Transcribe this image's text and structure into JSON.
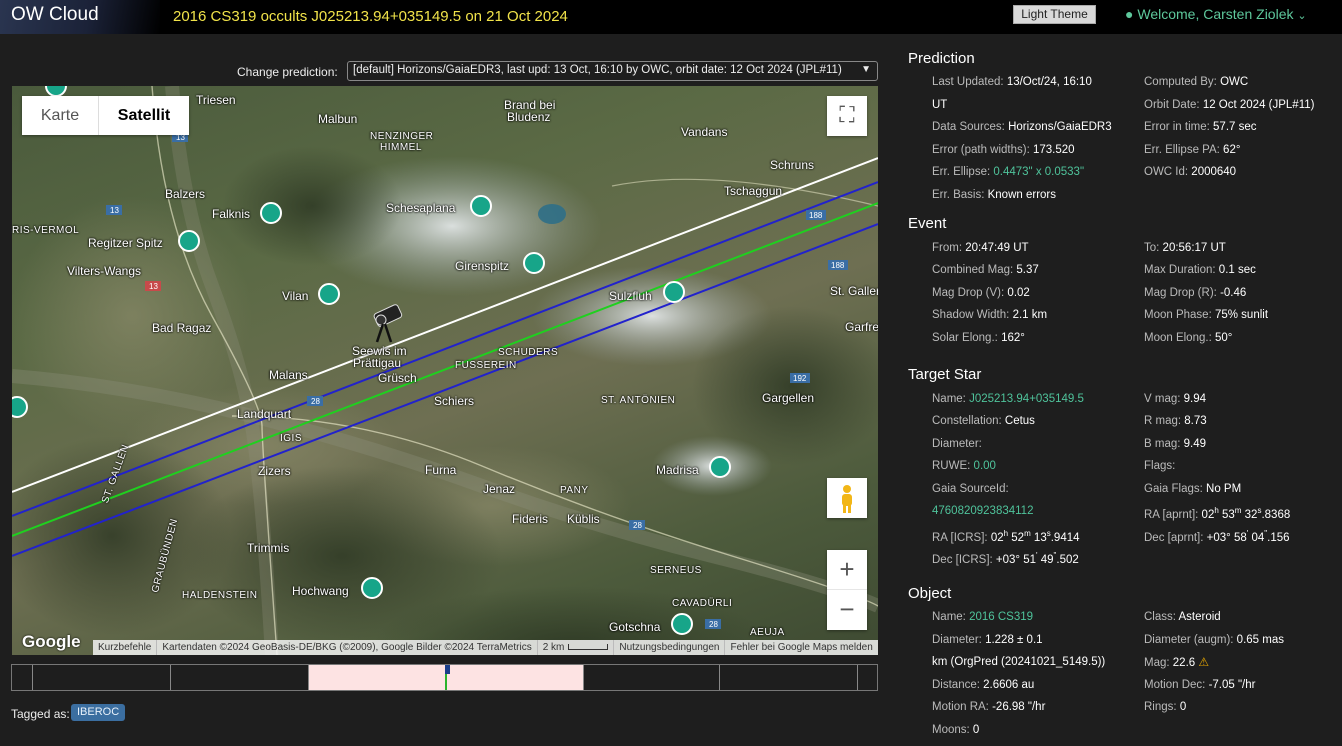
{
  "header": {
    "logo": "OW Cloud",
    "event_title": "2016 CS319 occults J025213.94+035149.5 on 21 Oct 2024",
    "theme_button": "Light Theme",
    "welcome": "Welcome, Carsten Ziolek",
    "colors": {
      "title": "#f1e34a",
      "welcome": "#5ec89c"
    }
  },
  "prediction_selector": {
    "label": "Change prediction:",
    "selected": "[default] Horizons/GaiaEDR3, last upd: 13 Oct, 16:10 by OWC, orbit date: 12 Oct 2024 (JPL#11)"
  },
  "map": {
    "type_buttons": {
      "map": "Karte",
      "satellite": "Satellit"
    },
    "google": "Google",
    "attribution": {
      "shortcuts": "Kurzbefehle",
      "data": "Kartendaten ©2024 GeoBasis-DE/BKG (©2009), Google Bilder ©2024 TerraMetrics",
      "scale": "2 km",
      "terms": "Nutzungsbedingungen",
      "report": "Fehler bei Google Maps melden"
    },
    "places": {
      "triesen": "Triesen",
      "malbun": "Malbun",
      "brand": "Brand bei",
      "bludenz": "Bludenz",
      "nenzinger": "NENZINGER",
      "himmel": "HIMMEL",
      "vandans": "Vandans",
      "schruns": "Schruns",
      "balzers": "Balzers",
      "falknis": "Falknis",
      "schesaplana": "Schesaplana",
      "tschaggun": "Tschaggun",
      "regitzen": "Regitzer Spitz",
      "vilters": "Vilters-Wangs",
      "girenspitz": "Girenspitz",
      "sulzfluh": "Sulzfluh",
      "stgallen": "St. Galler",
      "vilan": "Vilan",
      "badragaz": "Bad Ragaz",
      "garfre": "Garfre",
      "seewis": "Seewis im",
      "prattigau": "Prättigau",
      "schuders": "SCHUDERS",
      "fusserein": "FUSSEREIN",
      "malans": "Malans",
      "grusch": "Grüsch",
      "landquart": "Landquart",
      "schiers": "Schiers",
      "stantonien": "ST. ANTÖNIEN",
      "gargellen": "Gargellen",
      "igis": "IGIS",
      "zizers": "Zizers",
      "furna": "Furna",
      "madrisa": "Madrisa",
      "jenaz": "Jenaz",
      "pany": "PANY",
      "fideris": "Fideris",
      "kublis": "Küblis",
      "trimmis": "Trimmis",
      "serneus": "SERNEUS",
      "hochwang": "Hochwang",
      "haldenstein": "HALDENSTEIN",
      "cavadurli": "CAVADÜRLI",
      "gotschna": "Gotschna",
      "aeuja": "AEUJA",
      "stgallen_v": "ST. GALLEN",
      "graubunden_v": "GRAUBÜNDEN",
      "rsvermol": "RIS-VERMOL"
    },
    "road_labels": [
      "13",
      "13",
      "13",
      "188",
      "188",
      "192",
      "28",
      "28",
      "28"
    ],
    "colors": {
      "north_limit": "#2222cc",
      "centre": "#1fd01f",
      "south_limit": "#2222cc",
      "sigma": "#ffffff"
    }
  },
  "tagged": {
    "label": "Tagged as:",
    "tag": "IBEROC"
  },
  "panel": {
    "prediction": {
      "title": "Prediction",
      "last_updated_label": "Last Updated:",
      "last_updated_value": "13/Oct/24, 16:10",
      "last_updated_unit": "UT",
      "computed_by_label": "Computed By:",
      "computed_by_value": "OWC",
      "data_sources_label": "Data Sources:",
      "data_sources_value": "Horizons/GaiaEDR3",
      "orbit_date_label": "Orbit Date:",
      "orbit_date_value": "12 Oct 2024 (JPL#11)",
      "error_widths_label": "Error (path widths):",
      "error_widths_value": "173.520",
      "error_time_label": "Error in time:",
      "error_time_value": "57.7 sec",
      "err_ellipse_label": "Err. Ellipse:",
      "err_ellipse_value": "0.4473\" x 0.0533\"",
      "err_pa_label": "Err. Ellipse PA:",
      "err_pa_value": "62°",
      "err_basis_label": "Err. Basis:",
      "err_basis_value": "Known errors",
      "owc_id_label": "OWC Id:",
      "owc_id_value": "2000640"
    },
    "event": {
      "title": "Event",
      "from_label": "From:",
      "from_value": "20:47:49 UT",
      "to_label": "To:",
      "to_value": "20:56:17 UT",
      "combined_mag_label": "Combined Mag:",
      "combined_mag_value": "5.37",
      "max_dur_label": "Max Duration:",
      "max_dur_value": "0.1 sec",
      "drop_v_label": "Mag Drop (V):",
      "drop_v_value": "0.02",
      "drop_r_label": "Mag Drop (R):",
      "drop_r_value": "-0.46",
      "shadow_label": "Shadow Width:",
      "shadow_value": "2.1 km",
      "moon_phase_label": "Moon Phase:",
      "moon_phase_value": "75% sunlit",
      "solar_elong_label": "Solar Elong.:",
      "solar_elong_value": "162°",
      "moon_elong_label": "Moon Elong.:",
      "moon_elong_value": "50°"
    },
    "target_star": {
      "title": "Target Star",
      "name_label": "Name:",
      "name_value": "J025213.94+035149.5",
      "vmag_label": "V mag:",
      "vmag_value": "9.94",
      "const_label": "Constellation:",
      "const_value": "Cetus",
      "rmag_label": "R mag:",
      "rmag_value": "8.73",
      "diam_label": "Diameter:",
      "bmag_label": "B mag:",
      "bmag_value": "9.49",
      "ruwe_label": "RUWE:",
      "ruwe_value": "0.00",
      "flags_label": "Flags:",
      "gaia_src_label": "Gaia SourceId:",
      "gaia_src_value": "4760820923834112",
      "gaia_flags_label": "Gaia Flags:",
      "gaia_flags_value": "No PM",
      "ra_aprnt_label": "RA [aprnt]:",
      "ra_icrs_label": "RA [ICRS]:",
      "dec_aprnt_label": "Dec [aprnt]:",
      "dec_icrs_label": "Dec [ICRS]:"
    },
    "object": {
      "title": "Object",
      "name_label": "Name:",
      "name_value": "2016 CS319",
      "class_label": "Class:",
      "class_value": "Asteroid",
      "diam_label": "Diameter:",
      "diam_value": "1.228 ± 0.1",
      "diam_augm_label": "Diameter (augm):",
      "diam_augm_value": "0.65 mas",
      "diam_unit": "km",
      "diam_note": "(OrgPred (20241021_5149.5))",
      "mag_label": "Mag:",
      "mag_value": "22.6",
      "dist_label": "Distance:",
      "dist_value": "2.6606 au",
      "motion_dec_label": "Motion Dec:",
      "motion_dec_value": "-7.05 \"/hr",
      "motion_ra_label": "Motion RA:",
      "motion_ra_value": "-26.98 \"/hr",
      "rings_label": "Rings:",
      "rings_value": "0",
      "moons_label": "Moons:",
      "moons_value": "0"
    }
  }
}
